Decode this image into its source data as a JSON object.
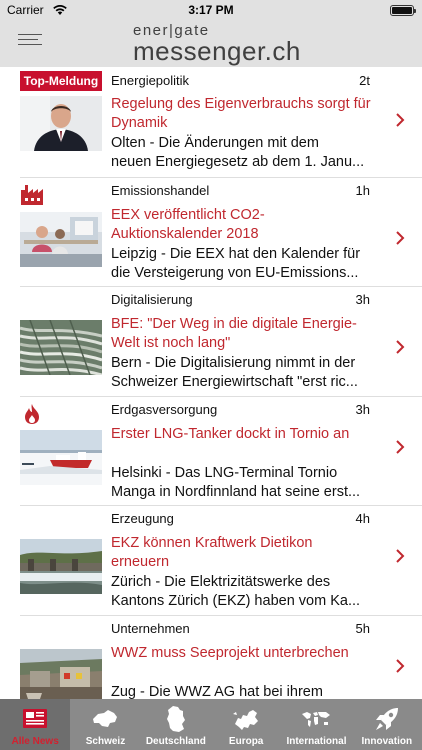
{
  "status_bar": {
    "carrier": "Carrier",
    "time": "3:17 PM"
  },
  "header": {
    "logo_top": "ener|gate",
    "logo_main": "messenger.ch",
    "menu_icon": "hamburger-menu-icon"
  },
  "news": [
    {
      "badge": "Top-Meldung",
      "category": "Energiepolitik",
      "time": "2t",
      "title": "Regelung des Eigenverbrauchs sorgt für Dynamik",
      "summary_lines": [
        "Olten - Die Änderungen mit dem",
        "neuen Energiegesetz ab dem 1. Janu..."
      ],
      "thumbnail": "portrait-photo"
    },
    {
      "category_icon": "factory-icon",
      "category": "Emissionshandel",
      "time": "1h",
      "title": "EEX veröffentlicht CO2-Auktionskalender 2018",
      "summary_lines": [
        "Leipzig - Die EEX hat den Kalender für",
        "die Versteigerung von EU-Emissions..."
      ],
      "thumbnail": "office-photo"
    },
    {
      "category": "Digitalisierung",
      "time": "3h",
      "title": "BFE: \"Der Weg in die digitale Energie-Welt ist noch lang\"",
      "summary_lines": [
        "Bern - Die Digitalisierung nimmt in der",
        "Schweizer Energiewirtschaft \"erst ric..."
      ],
      "thumbnail": "cables-photo"
    },
    {
      "category_icon": "flame-icon",
      "category": "Erdgasversorgung",
      "time": "3h",
      "title": "Erster LNG-Tanker dockt in Tornio an",
      "summary_lines": [
        "Helsinki - Das LNG-Terminal Tornio",
        "Manga in Nordfinnland hat seine erst..."
      ],
      "thumbnail": "tanker-photo"
    },
    {
      "category": "Erzeugung",
      "time": "4h",
      "title": "EKZ können Kraftwerk Dietikon erneuern",
      "summary_lines": [
        "Zürich - Die Elektrizitätswerke des",
        "Kantons Zürich (EKZ) haben vom Ka..."
      ],
      "thumbnail": "dam-photo"
    },
    {
      "category": "Unternehmen",
      "time": "5h",
      "title": "WWZ muss Seeprojekt unterbrechen",
      "summary_lines": [
        "Zug - Die WWZ AG hat bei ihrem"
      ],
      "thumbnail": "construction-photo"
    }
  ],
  "tabs": [
    {
      "label": "Alle News",
      "icon": "newspaper-icon",
      "active": true
    },
    {
      "label": "Schweiz",
      "icon": "switzerland-map-icon"
    },
    {
      "label": "Deutschland",
      "icon": "germany-map-icon"
    },
    {
      "label": "Europa",
      "icon": "europe-map-icon"
    },
    {
      "label": "International",
      "icon": "world-map-icon"
    },
    {
      "label": "Innovation",
      "icon": "rocket-icon"
    }
  ],
  "colors": {
    "accent_red": "#c8102e",
    "title_red": "#c0282f",
    "bar_gray": "#e1e1e1",
    "tab_gray": "#8a8a8a"
  }
}
